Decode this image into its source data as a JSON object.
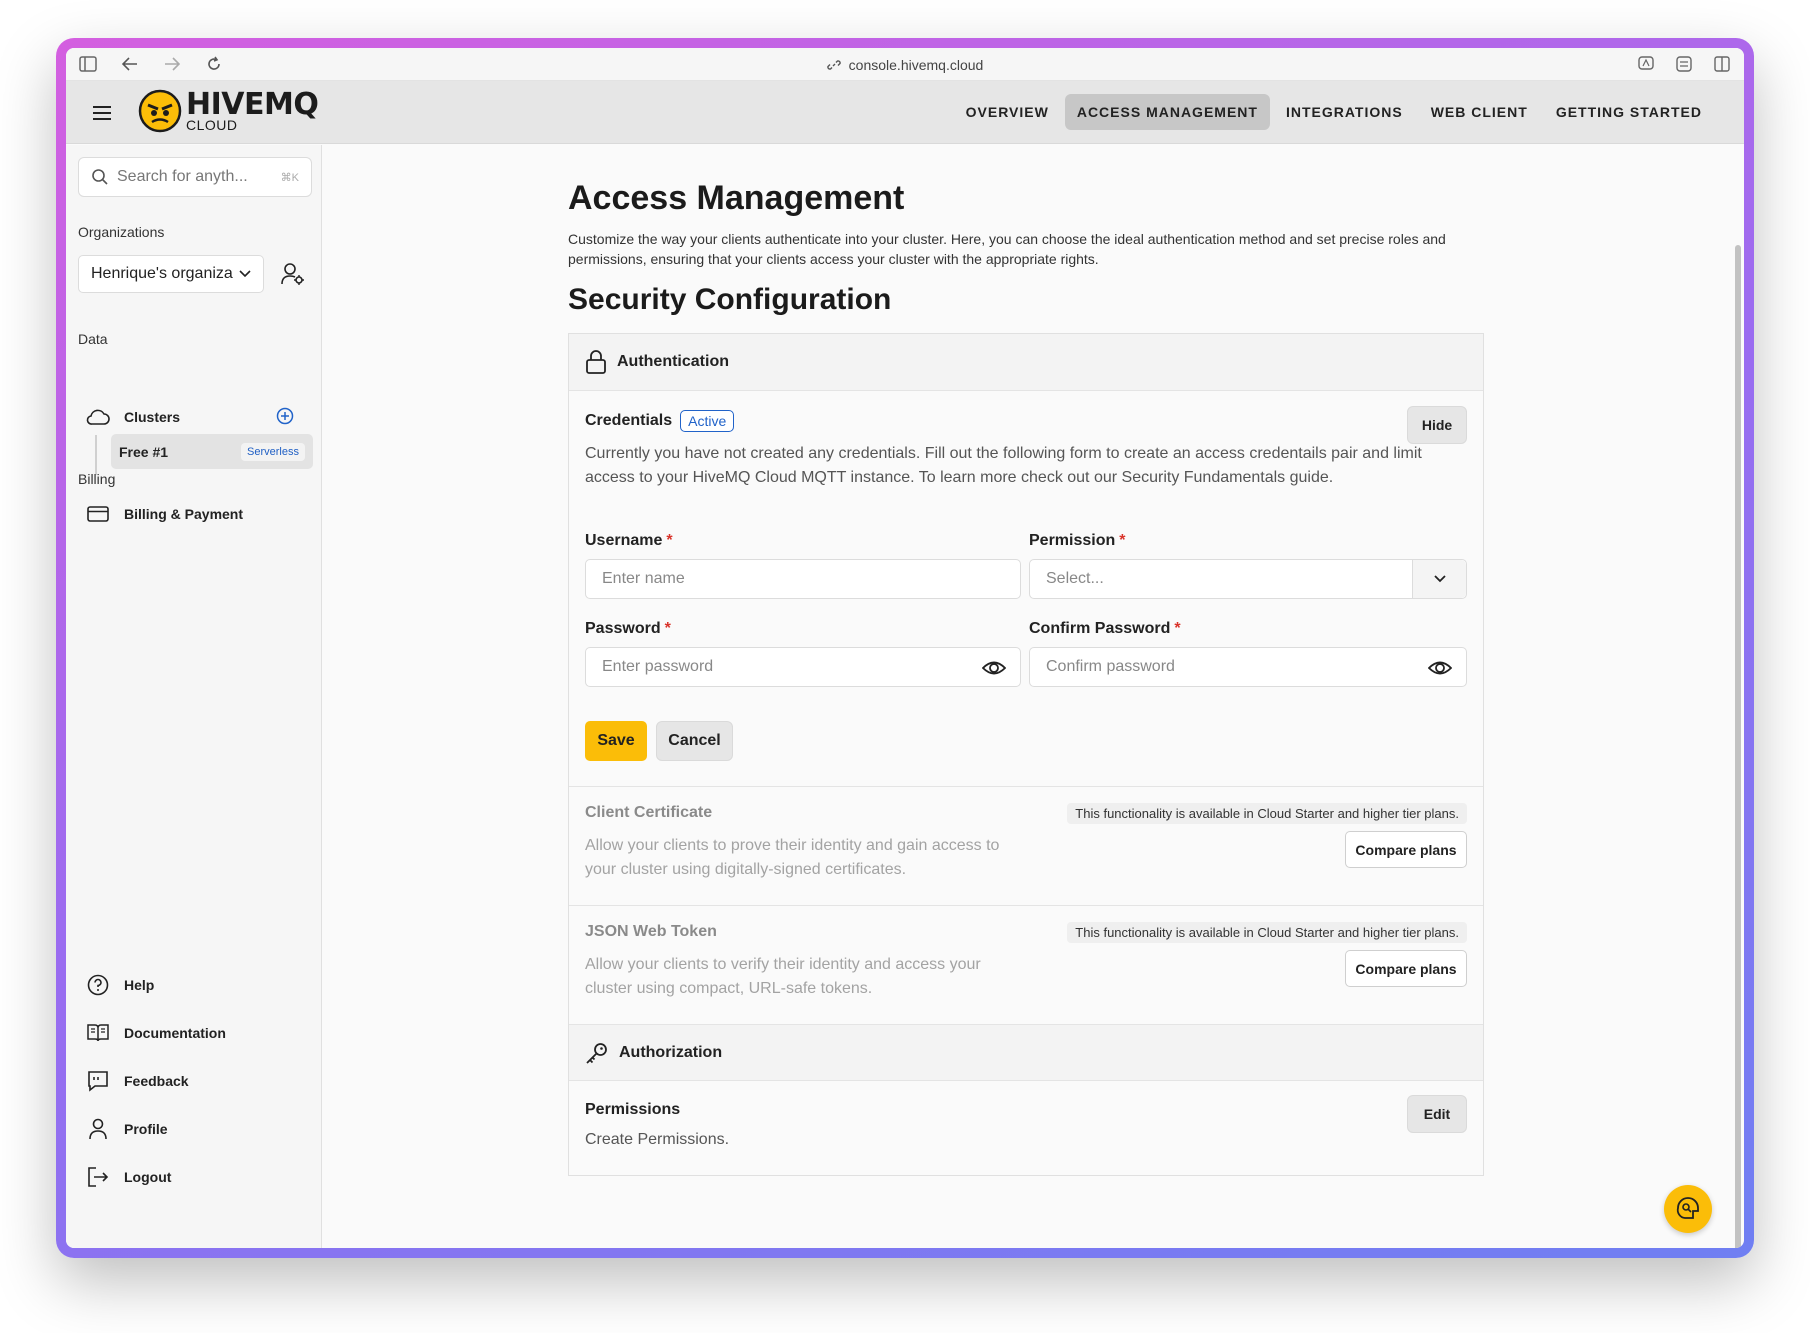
{
  "browser": {
    "url": "console.hivemq.cloud"
  },
  "header": {
    "logo_main": "HIVEMQ",
    "logo_sub": "CLOUD",
    "tabs": [
      {
        "label": "OVERVIEW",
        "active": false
      },
      {
        "label": "ACCESS MANAGEMENT",
        "active": true
      },
      {
        "label": "INTEGRATIONS",
        "active": false
      },
      {
        "label": "WEB CLIENT",
        "active": false
      },
      {
        "label": "GETTING STARTED",
        "active": false
      }
    ]
  },
  "sidebar": {
    "search_placeholder": "Search for anyth...",
    "search_shortcut": "⌘K",
    "organizations_label": "Organizations",
    "org_selected": "Henrique's organization",
    "data_label": "Data",
    "clusters_label": "Clusters",
    "cluster_name": "Free #1",
    "cluster_badge": "Serverless",
    "billing_label": "Billing",
    "billing_item": "Billing & Payment",
    "bottom_items": [
      "Help",
      "Documentation",
      "Feedback",
      "Profile",
      "Logout"
    ]
  },
  "main": {
    "title": "Access Management",
    "intro": "Customize the way your clients authenticate into your cluster. Here, you can choose the ideal authentication method and set precise roles and permissions, ensuring that your clients access your cluster with the appropriate rights.",
    "section_title": "Security Configuration",
    "authentication": {
      "heading": "Authentication",
      "credentials_title": "Credentials",
      "credentials_status": "Active",
      "hide_label": "Hide",
      "description": "Currently you have not created any credentials. Fill out the following form to create an access credentails pair and limit access to your HiveMQ Cloud MQTT instance. To learn more check out our Security Fundamentals guide.",
      "username_label": "Username",
      "username_placeholder": "Enter name",
      "permission_label": "Permission",
      "permission_placeholder": "Select...",
      "password_label": "Password",
      "password_placeholder": "Enter password",
      "confirm_label": "Confirm Password",
      "confirm_placeholder": "Confirm password",
      "required_mark": "*",
      "save_label": "Save",
      "cancel_label": "Cancel"
    },
    "client_certificate": {
      "title": "Client Certificate",
      "description": "Allow your clients to prove their identity and gain access to your cluster using digitally-signed certificates.",
      "tier_note": "This functionality is available in Cloud Starter and higher tier plans.",
      "compare_label": "Compare plans"
    },
    "jwt": {
      "title": "JSON Web Token",
      "description": "Allow your clients to verify their identity and access your cluster using compact, URL-safe tokens.",
      "tier_note": "This functionality is available in Cloud Starter and higher tier plans.",
      "compare_label": "Compare plans"
    },
    "authorization": {
      "heading": "Authorization",
      "permissions_title": "Permissions",
      "permissions_desc": "Create Permissions.",
      "edit_label": "Edit"
    }
  },
  "colors": {
    "accent": "#fbbd08",
    "link_blue": "#2163c9",
    "required_red": "#d9342b"
  }
}
